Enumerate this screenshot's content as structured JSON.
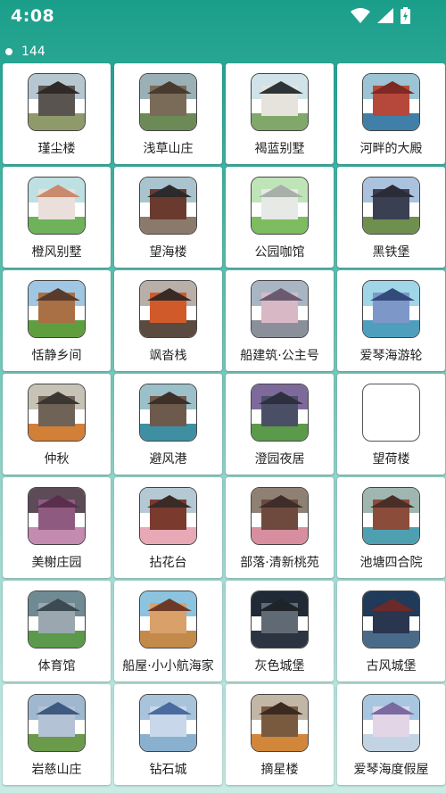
{
  "status_bar": {
    "time": "4:08"
  },
  "header": {
    "count": "144"
  },
  "items": [
    {
      "label": "瑾尘楼",
      "colors": {
        "sky": "#b7c7d2",
        "ground": "#8f9a6b",
        "building": "#5a5450",
        "roof": "#2f2a28"
      }
    },
    {
      "label": "浅草山庄",
      "colors": {
        "sky": "#9ab0b6",
        "ground": "#6c8a55",
        "building": "#7a6a58",
        "roof": "#4a3b30"
      }
    },
    {
      "label": "褐蓝别墅",
      "colors": {
        "sky": "#cfe3e8",
        "ground": "#7fa86a",
        "building": "#e6e3dc",
        "roof": "#2d3438"
      }
    },
    {
      "label": "河畔的大殿",
      "colors": {
        "sky": "#9cc4d4",
        "ground": "#3f7fa8",
        "building": "#b5483a",
        "roof": "#7d2a22"
      }
    },
    {
      "label": "橙风别墅",
      "colors": {
        "sky": "#bfe0e3",
        "ground": "#6eb35b",
        "building": "#eadfda",
        "roof": "#c98a6d"
      }
    },
    {
      "label": "望海楼",
      "colors": {
        "sky": "#a9c4cf",
        "ground": "#8b7a6c",
        "building": "#6b3a2e",
        "roof": "#2c2a2a"
      }
    },
    {
      "label": "公园咖馆",
      "colors": {
        "sky": "#bfe4b8",
        "ground": "#7ebd5f",
        "building": "#e6e9e6",
        "roof": "#a6b0a9"
      }
    },
    {
      "label": "黑铁堡",
      "colors": {
        "sky": "#aac2de",
        "ground": "#6f8f4f",
        "building": "#3a3f52",
        "roof": "#2a2d38"
      }
    },
    {
      "label": "恬静乡间",
      "colors": {
        "sky": "#9fc7e3",
        "ground": "#5f9e3f",
        "building": "#a96f45",
        "roof": "#5a3a2a"
      }
    },
    {
      "label": "飒沓栈",
      "colors": {
        "sky": "#b8b0a8",
        "ground": "#5b4a3f",
        "building": "#d05a2a",
        "roof": "#3a2a26"
      }
    },
    {
      "label": "船建筑·公主号",
      "colors": {
        "sky": "#a8b6c4",
        "ground": "#8a8f9a",
        "building": "#d9b8c6",
        "roof": "#6a5a70"
      }
    },
    {
      "label": "爱琴海游轮",
      "colors": {
        "sky": "#9fd6e8",
        "ground": "#4e9fbd",
        "building": "#7e97c9",
        "roof": "#334a7a"
      }
    },
    {
      "label": "仲秋",
      "colors": {
        "sky": "#c7c2b6",
        "ground": "#d27f38",
        "building": "#6f6257",
        "roof": "#3b3632"
      }
    },
    {
      "label": "避风港",
      "colors": {
        "sky": "#9bc0c9",
        "ground": "#3f8fa3",
        "building": "#6d5a4c",
        "roof": "#3d3029"
      }
    },
    {
      "label": "澄园夜居",
      "colors": {
        "sky": "#7d6a9a",
        "ground": "#5a9a4a",
        "building": "#4a4f66",
        "roof": "#2e3040"
      }
    },
    {
      "label": "望荷楼",
      "empty": true
    },
    {
      "label": "美榭庄园",
      "colors": {
        "sky": "#5d4b57",
        "ground": "#c48ab0",
        "building": "#8f5a80",
        "roof": "#5a2f4d"
      }
    },
    {
      "label": "拈花台",
      "colors": {
        "sky": "#b4c9d3",
        "ground": "#e7a9b5",
        "building": "#7a3a2e",
        "roof": "#3a2a28"
      }
    },
    {
      "label": "部落·清新桃苑",
      "colors": {
        "sky": "#8f8074",
        "ground": "#d78fa0",
        "building": "#6e4a3e",
        "roof": "#3e2d29"
      }
    },
    {
      "label": "池塘四合院",
      "colors": {
        "sky": "#9fb7b0",
        "ground": "#4ea0b0",
        "building": "#8b4c3a",
        "roof": "#4a2f28"
      }
    },
    {
      "label": "体育馆",
      "colors": {
        "sky": "#6f8a92",
        "ground": "#5a9a4a",
        "building": "#9aa7ae",
        "roof": "#3c4a52"
      }
    },
    {
      "label": "船屋·小小航海家",
      "colors": {
        "sky": "#8cc4e0",
        "ground": "#c48a4a",
        "building": "#d9a06a",
        "roof": "#6e3a28"
      }
    },
    {
      "label": "灰色城堡",
      "colors": {
        "sky": "#1f2a36",
        "ground": "#2b3440",
        "building": "#606a74",
        "roof": "#1e242a"
      }
    },
    {
      "label": "古风城堡",
      "colors": {
        "sky": "#203a5a",
        "ground": "#4a6a8a",
        "building": "#2a3550",
        "roof": "#6a2a2a"
      }
    },
    {
      "label": "岩慈山庄",
      "colors": {
        "sky": "#9fb8cf",
        "ground": "#6a9a4a",
        "building": "#b3c2d4",
        "roof": "#3e5a80"
      }
    },
    {
      "label": "钻石城",
      "colors": {
        "sky": "#a9c3da",
        "ground": "#8ab0cf",
        "building": "#c9d7ea",
        "roof": "#4a6aa0"
      }
    },
    {
      "label": "摘星楼",
      "colors": {
        "sky": "#c2b6a6",
        "ground": "#d2863a",
        "building": "#7a5a3e",
        "roof": "#3a2a22"
      }
    },
    {
      "label": "爱琴海度假屋",
      "colors": {
        "sky": "#a9c6e0",
        "ground": "#c2d4e4",
        "building": "#e2d6e6",
        "roof": "#7a6aa2"
      }
    }
  ]
}
